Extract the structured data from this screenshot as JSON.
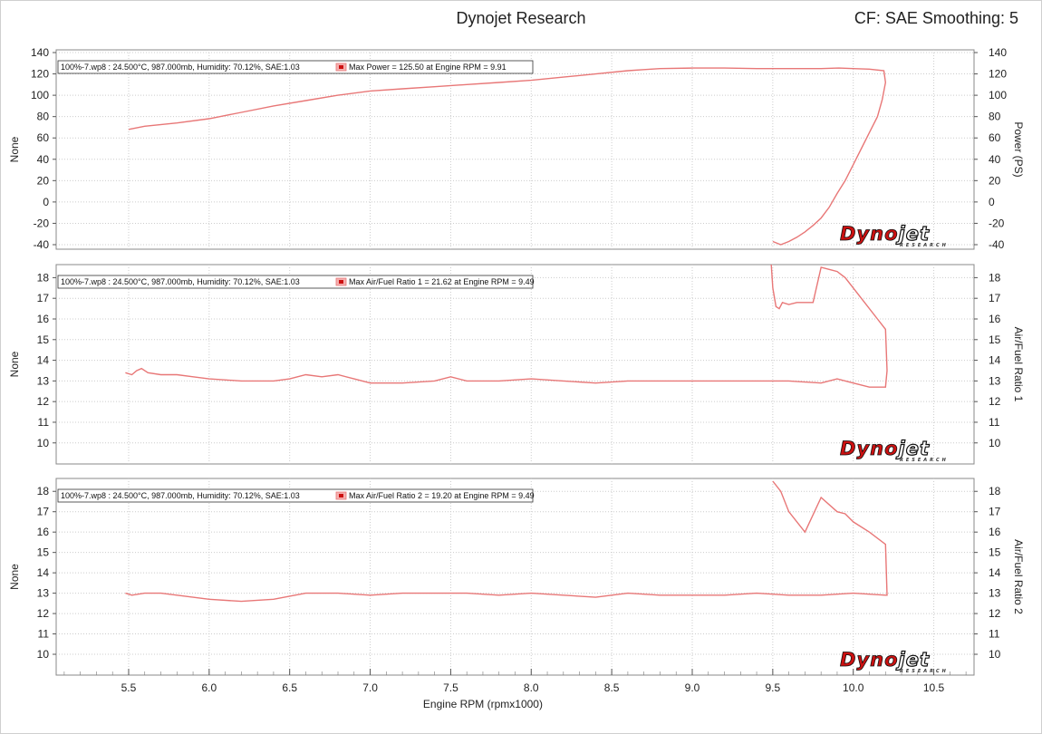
{
  "header": {
    "title": "Dynojet Research",
    "correction": "CF: SAE Smoothing: 5"
  },
  "colors": {
    "series": "#e87777",
    "grid": "#cccccc",
    "logo_red": "#cc1111",
    "logo_black": "#111111"
  },
  "logo": {
    "word_left": "Dyno",
    "word_right": "jet",
    "sub": "RESEARCH"
  },
  "chart_data": [
    {
      "type": "line",
      "left_label": "None",
      "right_label": "Power (PS)",
      "ylim": [
        -40,
        140
      ],
      "yticks": [
        -40,
        -20,
        0,
        20,
        40,
        60,
        80,
        100,
        120,
        140
      ],
      "legend_info": "100%-7.wp8 : 24.500°C, 987.000mb, Humidity: 70.12%, SAE:1.03",
      "legend_series": "Max Power = 125.50 at Engine RPM = 9.91",
      "series": [
        {
          "x": [
            5.5,
            5.6,
            5.8,
            6.0,
            6.2,
            6.4,
            6.6,
            6.8,
            7.0,
            7.2,
            7.4,
            7.6,
            7.8,
            8.0,
            8.2,
            8.4,
            8.6,
            8.7,
            8.8,
            9.0,
            9.2,
            9.4,
            9.6,
            9.8,
            9.91,
            10.0,
            10.1,
            10.19,
            10.2,
            10.18,
            10.15,
            10.1,
            10.05,
            10.0,
            9.95,
            9.9,
            9.85,
            9.8,
            9.75,
            9.7,
            9.65,
            9.6,
            9.55,
            9.5
          ],
          "y": [
            68,
            71,
            74,
            78,
            84,
            90,
            95,
            100,
            104,
            106,
            108,
            110,
            112,
            114,
            117,
            120,
            123,
            124,
            125,
            125.5,
            125.5,
            125,
            125,
            125,
            125.5,
            125,
            124.5,
            123,
            112,
            96,
            80,
            65,
            50,
            35,
            20,
            8,
            -5,
            -15,
            -22,
            -28,
            -33,
            -37,
            -40,
            -37
          ]
        }
      ]
    },
    {
      "type": "line",
      "left_label": "None",
      "right_label": "Air/Fuel Ratio 1",
      "ylim": [
        9.2,
        18.5
      ],
      "yticks": [
        10,
        11,
        12,
        13,
        14,
        15,
        16,
        17,
        18
      ],
      "legend_info": "100%-7.wp8 : 24.500°C, 987.000mb, Humidity: 70.12%, SAE:1.03",
      "legend_series": "Max Air/Fuel Ratio 1 = 21.62 at Engine RPM = 9.49",
      "series": [
        {
          "x": [
            5.48,
            5.52,
            5.55,
            5.58,
            5.62,
            5.7,
            5.8,
            5.9,
            6.0,
            6.2,
            6.4,
            6.5,
            6.6,
            6.7,
            6.8,
            6.9,
            7.0,
            7.2,
            7.4,
            7.5,
            7.6,
            7.8,
            8.0,
            8.2,
            8.4,
            8.6,
            8.8,
            9.0,
            9.2,
            9.4,
            9.6,
            9.8,
            9.9,
            10.0,
            10.1,
            10.2,
            10.21,
            10.2,
            10.15,
            10.05,
            9.95,
            9.9,
            9.85,
            9.8,
            9.75,
            9.65,
            9.6,
            9.56,
            9.54,
            9.52,
            9.5,
            9.49
          ],
          "y": [
            13.4,
            13.3,
            13.5,
            13.6,
            13.4,
            13.3,
            13.3,
            13.2,
            13.1,
            13.0,
            13.0,
            13.1,
            13.3,
            13.2,
            13.3,
            13.1,
            12.9,
            12.9,
            13.0,
            13.2,
            13.0,
            13.0,
            13.1,
            13.0,
            12.9,
            13.0,
            13.0,
            13.0,
            13.0,
            13.0,
            13.0,
            12.9,
            13.1,
            12.9,
            12.7,
            12.7,
            13.5,
            15.5,
            16.0,
            17.0,
            18.0,
            18.3,
            18.4,
            18.5,
            16.8,
            16.8,
            16.7,
            16.8,
            16.5,
            16.6,
            17.5,
            18.7
          ]
        }
      ]
    },
    {
      "type": "line",
      "left_label": "None",
      "right_label": "Air/Fuel Ratio 2",
      "ylim": [
        9.2,
        18.5
      ],
      "yticks": [
        10,
        11,
        12,
        13,
        14,
        15,
        16,
        17,
        18
      ],
      "legend_info": "100%-7.wp8 : 24.500°C, 987.000mb, Humidity: 70.12%, SAE:1.03",
      "legend_series": "Max Air/Fuel Ratio 2 = 19.20 at Engine RPM = 9.49",
      "series": [
        {
          "x": [
            5.48,
            5.52,
            5.6,
            5.7,
            5.8,
            6.0,
            6.2,
            6.4,
            6.6,
            6.8,
            7.0,
            7.2,
            7.4,
            7.6,
            7.8,
            8.0,
            8.2,
            8.4,
            8.6,
            8.8,
            9.0,
            9.2,
            9.4,
            9.6,
            9.8,
            10.0,
            10.2,
            10.21,
            10.2,
            10.1,
            10.0,
            9.95,
            9.9,
            9.8,
            9.7,
            9.6,
            9.55,
            9.5
          ],
          "y": [
            13.0,
            12.9,
            13.0,
            13.0,
            12.9,
            12.7,
            12.6,
            12.7,
            13.0,
            13.0,
            12.9,
            13.0,
            13.0,
            13.0,
            12.9,
            13.0,
            12.9,
            12.8,
            13.0,
            12.9,
            12.9,
            12.9,
            13.0,
            12.9,
            12.9,
            13.0,
            12.9,
            12.9,
            15.4,
            16.0,
            16.5,
            16.9,
            17.0,
            17.7,
            16.0,
            17.0,
            18.0,
            18.5
          ]
        }
      ]
    }
  ],
  "x_axis": {
    "label": "Engine RPM (rpmx1000)",
    "xlim": [
      5.05,
      10.75
    ],
    "ticks": [
      5.5,
      6.0,
      6.5,
      7.0,
      7.5,
      8.0,
      8.5,
      9.0,
      9.5,
      10.0,
      10.5
    ],
    "tick_labels": [
      "5.5",
      "6.0",
      "6.5",
      "7.0",
      "7.5",
      "8.0",
      "8.5",
      "9.0",
      "9.5",
      "10.0",
      "10.5"
    ]
  }
}
